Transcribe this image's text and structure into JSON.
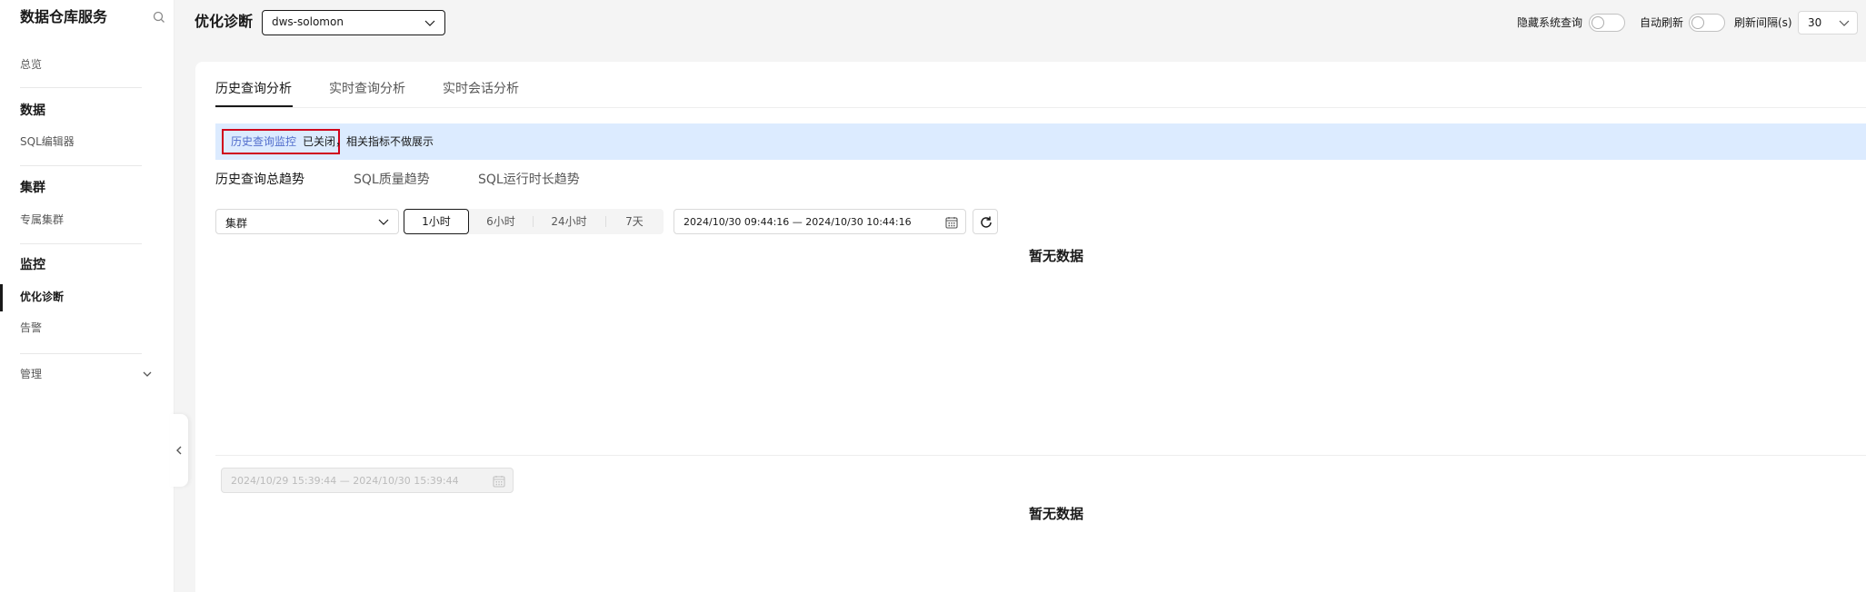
{
  "sidebar": {
    "title": "数据仓库服务",
    "search_icon": "search-icon",
    "items": {
      "overview": "总览",
      "data_group": "数据",
      "sql_editor": "SQL编辑器",
      "cluster_group": "集群",
      "dedicated_cluster": "专属集群",
      "monitor_group": "监控",
      "optimize": "优化诊断",
      "alarm": "告警",
      "manage": "管理"
    }
  },
  "header": {
    "title": "优化诊断",
    "instance": "dws-solomon",
    "hide_system_query_label": "隐藏系统查询",
    "hide_system_query_on": false,
    "auto_refresh_label": "自动刷新",
    "auto_refresh_on": false,
    "refresh_interval_label": "刷新间隔(s)",
    "refresh_interval": "30"
  },
  "tabs": [
    "历史查询分析",
    "实时查询分析",
    "实时会话分析"
  ],
  "active_tab": "历史查询分析",
  "banner": {
    "link": "历史查询监控",
    "text": "已关闭，相关指标不做展示"
  },
  "subtabs": [
    "历史查询总趋势",
    "SQL质量趋势",
    "SQL运行时长趋势"
  ],
  "active_subtab": "历史查询总趋势",
  "filters": {
    "cluster_placeholder": "集群",
    "ranges": [
      "1小时",
      "6小时",
      "24小时",
      "7天"
    ],
    "active_range": "1小时",
    "date_range": "2024/10/30 09:44:16 — 2024/10/30 10:44:16",
    "disabled_date_range": "2024/10/29 15:39:44 — 2024/10/30 15:39:44"
  },
  "empty_text": "暂无数据",
  "colors": {
    "accent": "#191919",
    "link": "#526ecc",
    "banner_bg": "#dcebff",
    "highlight_border": "#d0021b"
  }
}
